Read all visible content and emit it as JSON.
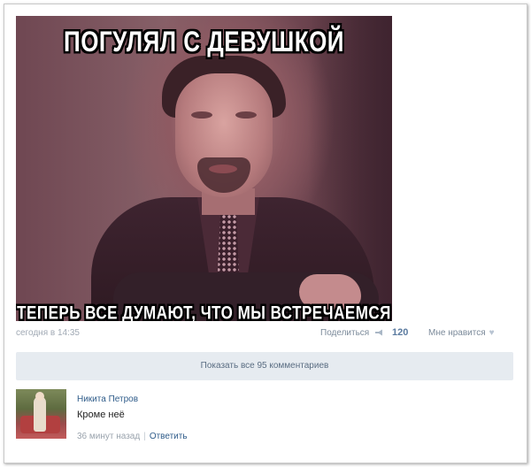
{
  "meme": {
    "caption_top": "ПОГУЛЯЛ С ДЕВУШКОЙ",
    "caption_bottom": "ТЕПЕРЬ ВСЕ ДУМАЮТ, ЧТО МЫ ВСТРЕЧАЕМСЯ"
  },
  "post_meta": {
    "date": "сегодня в 14:35",
    "share_label": "Поделиться",
    "share_icon": "megaphone-icon",
    "count": "120",
    "like_label": "Мне нравится",
    "like_icon": "heart-icon"
  },
  "comments": {
    "show_all_label": "Показать все 95 комментариев",
    "items": [
      {
        "author": "Никита Петров",
        "text": "Кроме неё",
        "time": "36 минут назад",
        "separator": "|",
        "reply_label": "Ответить"
      }
    ]
  },
  "colors": {
    "link": "#2f5c8a",
    "muted": "#a0a9b4",
    "bar_bg": "#e6ebf0"
  }
}
